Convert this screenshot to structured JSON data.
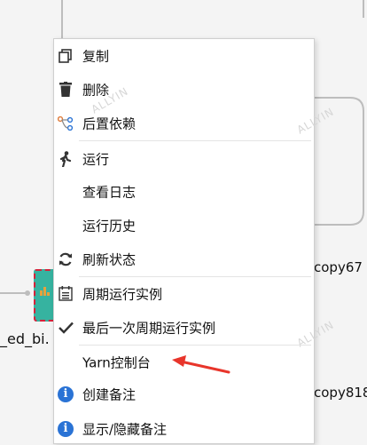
{
  "canvas": {
    "node_labels": [
      "_ed_bi.",
      "copy67",
      "copy818"
    ],
    "watermark": "ALLYIN"
  },
  "menu": {
    "items": [
      {
        "label": "复制",
        "icon": "copy-icon"
      },
      {
        "label": "删除",
        "icon": "trash-icon"
      },
      {
        "label": "后置依赖",
        "icon": "dependency-icon"
      },
      {
        "label": "运行",
        "icon": "run-icon"
      },
      {
        "label": "查看日志",
        "icon": ""
      },
      {
        "label": "运行历史",
        "icon": ""
      },
      {
        "label": "刷新状态",
        "icon": "refresh-icon"
      },
      {
        "label": "周期运行实例",
        "icon": "calendar-list-icon"
      },
      {
        "label": "最后一次周期运行实例",
        "icon": "checkmark-icon"
      },
      {
        "label": "Yarn控制台",
        "icon": ""
      },
      {
        "label": "创建备注",
        "icon": "info-icon"
      },
      {
        "label": "显示/隐藏备注",
        "icon": "info-icon"
      }
    ]
  },
  "colors": {
    "annotation_arrow": "#e8352b",
    "node_teal": "#36b3a0",
    "node_border_red": "#d6223a",
    "info_blue": "#2a73d5"
  }
}
